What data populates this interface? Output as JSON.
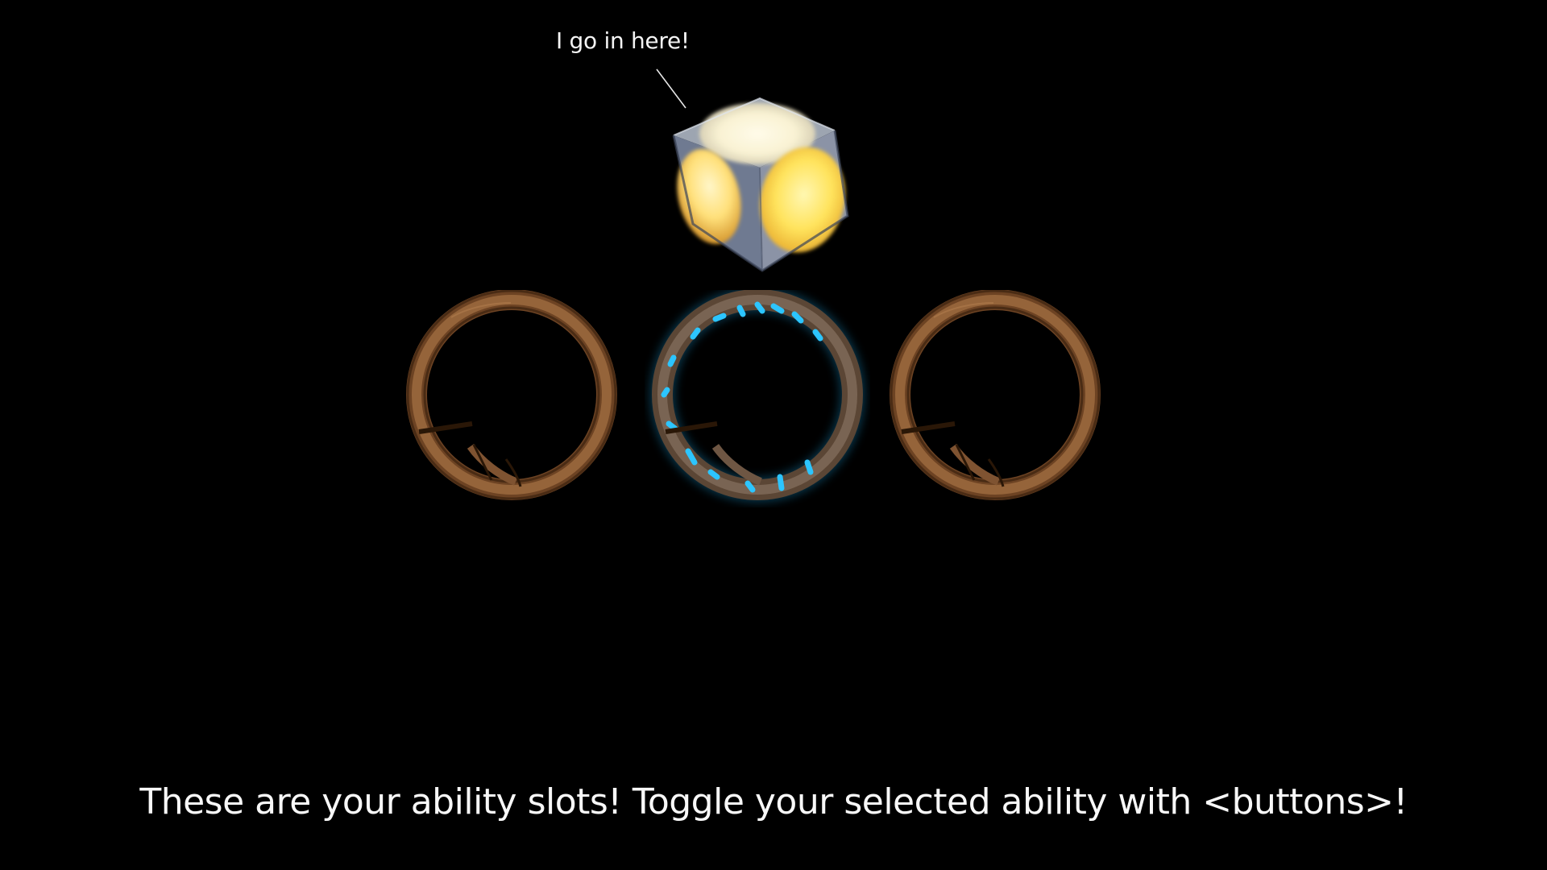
{
  "tutorial": {
    "callout_text": "I go in here!",
    "caption": "These are your ability slots! Toggle your selected ability with <buttons>!"
  },
  "ability_slots": [
    {
      "icon": "ring-slot-icon",
      "state": "idle"
    },
    {
      "icon": "ring-slot-icon",
      "state": "selected-glowing"
    },
    {
      "icon": "ring-slot-icon",
      "state": "idle"
    }
  ],
  "pickup": {
    "icon": "glowing-cube-icon"
  },
  "colors": {
    "background": "#000000",
    "ring_bronze": "#8a5a33",
    "glow_cyan": "#19b8ff",
    "cube_glow": "#ffd84a",
    "text": "#f8f8f8"
  }
}
